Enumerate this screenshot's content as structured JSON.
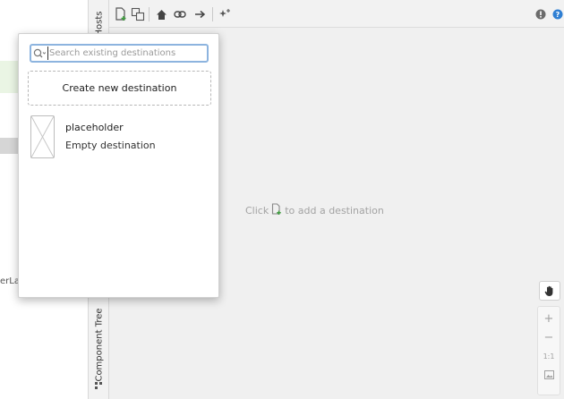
{
  "left_panel": {
    "fragment_text": "erLay"
  },
  "side_strip": {
    "hosts_tab": "Hosts",
    "component_tree_tab": "Component Tree"
  },
  "toolbar": {
    "icons": [
      "new-destination-icon",
      "nested-graph-icon",
      "home-icon",
      "link-icon",
      "action-arrow-icon",
      "auto-arrange-icon",
      "warning-icon",
      "help-icon"
    ]
  },
  "popup": {
    "search_placeholder": "Search existing destinations",
    "create_label": "Create new destination",
    "destinations": [
      {
        "name": "placeholder",
        "description": "Empty destination"
      }
    ]
  },
  "canvas": {
    "hint_prefix": "Click",
    "hint_suffix": "to add a destination"
  },
  "zoom_controls": {
    "zoom_in": "+",
    "zoom_out": "−",
    "actual_size": "1:1"
  },
  "colors": {
    "accent_green": "#3d9e3d",
    "focus_blue": "#8db4df",
    "canvas_bg": "#f0f0f0",
    "help_blue": "#2f7fd3"
  }
}
